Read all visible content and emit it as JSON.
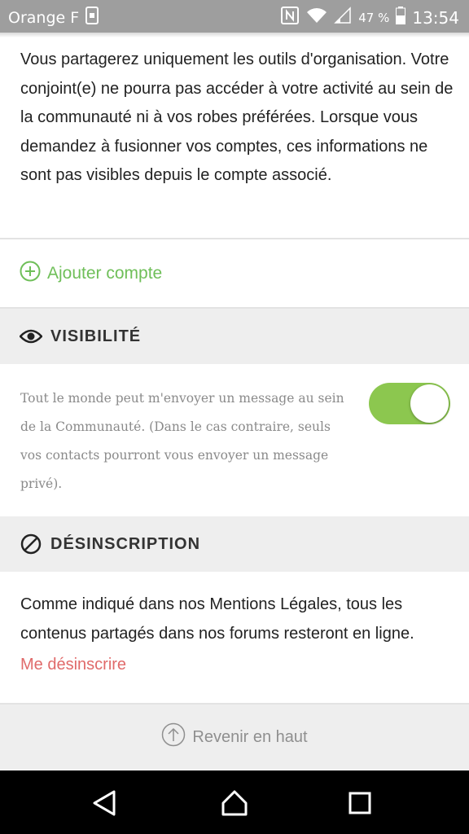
{
  "status_bar": {
    "carrier": "Orange F",
    "battery_percent": "47 %",
    "time": "13:54"
  },
  "intro": {
    "text": "Vous partagerez uniquement les outils d'organisation. Votre conjoint(e) ne pourra pas accéder à votre activité au sein de la communauté ni à vos robes préférées. Lorsque vous demandez à fusionner vos comptes, ces informations ne sont pas visibles depuis le compte associé."
  },
  "add_account": {
    "label": "Ajouter compte"
  },
  "visibility": {
    "title": "VISIBILITÉ",
    "description": "Tout le monde peut m'envoyer un message au sein de la Communauté. (Dans le cas contraire, seuls vos contacts pourront vous envoyer un message privé).",
    "toggle_on": true
  },
  "unsubscribe": {
    "title": "DÉSINSCRIPTION",
    "text": "Comme indiqué dans nos Mentions Légales, tous les contenus partagés dans nos forums resteront en ligne.",
    "link_label": "Me désinscrire"
  },
  "footer": {
    "back_to_top": "Revenir en haut"
  },
  "colors": {
    "accent_green": "#6fbf59",
    "toggle_green": "#8cc74f",
    "link_red": "#e06a6a",
    "section_bg": "#eeeeee"
  },
  "icons": {
    "add": "plus-circle-icon",
    "visibility": "eye-icon",
    "unsubscribe": "forbidden-icon",
    "back_to_top": "arrow-up-circle-icon"
  }
}
